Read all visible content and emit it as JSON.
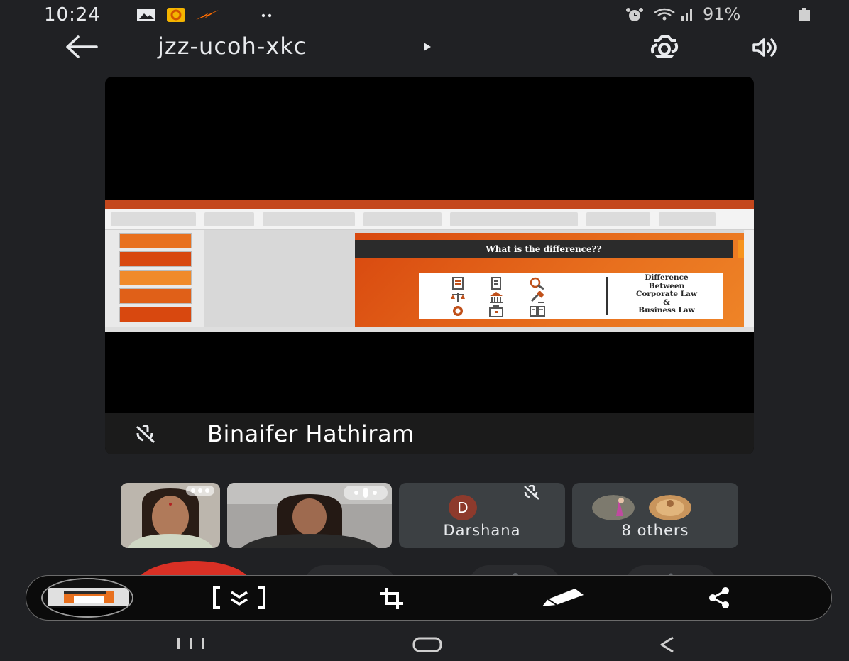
{
  "status_bar": {
    "time": "10:24",
    "battery": "91%"
  },
  "header": {
    "meeting_code": "jzz-ucoh-xkc"
  },
  "main_tile": {
    "presenter_name": "Binaifer Hathiram",
    "slide_title": "What is the difference??",
    "slide_card_lines": [
      "Difference",
      "Between",
      "Corporate Law",
      "&",
      "Business Law"
    ]
  },
  "participants": {
    "darshana_initial": "D",
    "darshana_name": "Darshana",
    "others_label": "8 others"
  },
  "colors": {
    "background": "#202124",
    "end_call": "#d93025",
    "slide_orange": "#e8701e"
  },
  "icons": [
    "back-arrow",
    "caret-right",
    "switch-camera",
    "speaker",
    "mic-off",
    "scroll-capture",
    "crop",
    "draw",
    "share",
    "recents",
    "home",
    "back"
  ]
}
